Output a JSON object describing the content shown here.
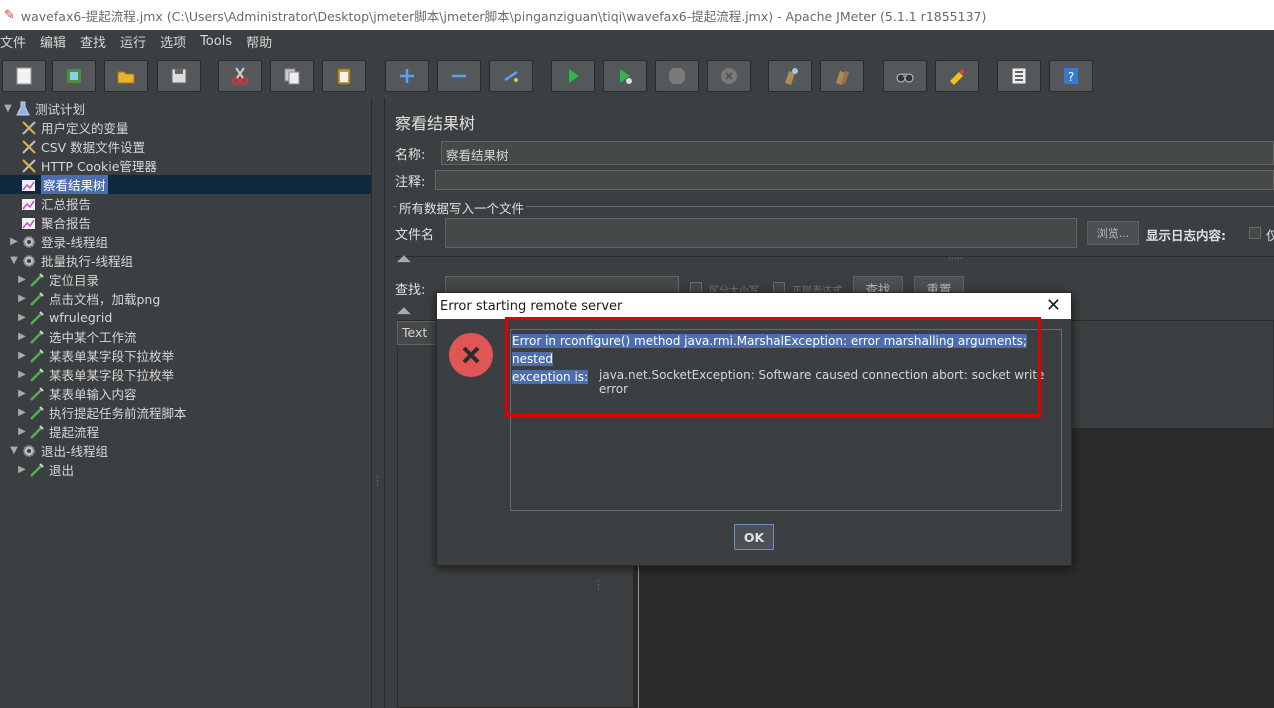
{
  "window": {
    "title": "wavefax6-提起流程.jmx (C:\\Users\\Administrator\\Desktop\\jmeter脚本\\jmeter脚本\\pinganziguan\\tiqi\\wavefax6-提起流程.jmx) - Apache JMeter (5.1.1 r1855137)"
  },
  "menu": [
    "文件",
    "编辑",
    "查找",
    "运行",
    "选项",
    "Tools",
    "帮助"
  ],
  "toolbar": {
    "icons": [
      "new-icon",
      "templates-icon",
      "open-icon",
      "save-icon",
      "cut-icon",
      "copy-icon",
      "paste-icon",
      "expand-icon",
      "collapse-icon",
      "toggle-icon",
      "start-icon",
      "start-no-pause-icon",
      "stop-icon",
      "shutdown-icon",
      "clear-icon",
      "clear-all-icon",
      "search-icon",
      "reset-search-icon",
      "function-helper-icon",
      "help-icon"
    ]
  },
  "tree": {
    "items": [
      {
        "label": "测试计划",
        "icon": "test-plan-icon",
        "indent": 0,
        "arrow": "▼"
      },
      {
        "label": "用户定义的变量",
        "icon": "config-icon",
        "indent": 1,
        "arrow": ""
      },
      {
        "label": "CSV 数据文件设置",
        "icon": "config-icon",
        "indent": 1,
        "arrow": ""
      },
      {
        "label": "HTTP Cookie管理器",
        "icon": "config-icon",
        "indent": 1,
        "arrow": ""
      },
      {
        "label": "察看结果树",
        "icon": "listener-icon",
        "indent": 1,
        "arrow": "",
        "selected": true
      },
      {
        "label": "汇总报告",
        "icon": "listener-icon",
        "indent": 1,
        "arrow": ""
      },
      {
        "label": "聚合报告",
        "icon": "listener-icon",
        "indent": 1,
        "arrow": ""
      },
      {
        "label": "登录-线程组",
        "icon": "thread-group-icon",
        "indent": 1,
        "arrow": "▶"
      },
      {
        "label": "批量执行-线程组",
        "icon": "thread-group-icon",
        "indent": 1,
        "arrow": "▼"
      },
      {
        "label": "定位目录",
        "icon": "sampler-icon",
        "indent": 2,
        "arrow": "▶"
      },
      {
        "label": "点击文档，加载png",
        "icon": "sampler-icon",
        "indent": 2,
        "arrow": "▶"
      },
      {
        "label": "wfrulegrid",
        "icon": "sampler-icon",
        "indent": 2,
        "arrow": "▶"
      },
      {
        "label": "选中某个工作流",
        "icon": "sampler-icon",
        "indent": 2,
        "arrow": "▶"
      },
      {
        "label": "某表单某字段下拉枚举",
        "icon": "sampler-icon",
        "indent": 2,
        "arrow": "▶"
      },
      {
        "label": "某表单某字段下拉枚举",
        "icon": "sampler-icon",
        "indent": 2,
        "arrow": "▶"
      },
      {
        "label": "某表单输入内容",
        "icon": "sampler-icon",
        "indent": 2,
        "arrow": "▶"
      },
      {
        "label": "执行提起任务前流程脚本",
        "icon": "sampler-icon",
        "indent": 2,
        "arrow": "▶"
      },
      {
        "label": "提起流程",
        "icon": "sampler-icon",
        "indent": 2,
        "arrow": "▶"
      },
      {
        "label": "退出-线程组",
        "icon": "thread-group-icon",
        "indent": 1,
        "arrow": "▼"
      },
      {
        "label": "退出",
        "icon": "sampler-icon",
        "indent": 2,
        "arrow": "▶"
      }
    ]
  },
  "panel": {
    "title": "察看结果树",
    "name_label": "名称:",
    "name_value": "察看结果树",
    "comment_label": "注释:",
    "group_legend": "所有数据写入一个文件",
    "filename_label": "文件名",
    "browse_label": "浏览...",
    "log_content_label": "显示日志内容:",
    "log_content_tail": "仅",
    "search_label": "查找:",
    "case_sensitive_label": "区分大小写",
    "regex_label": "正则表达式",
    "find_button": "查找",
    "reset_button": "重置",
    "renderer_value": "Text"
  },
  "dialog": {
    "title": "Error starting remote server",
    "message_line1": "Error in rconfigure() method java.rmi.MarshalException: error marshalling arguments; nested",
    "message_line2": "exception is:",
    "message_line3": "java.net.SocketException: Software caused connection abort: socket write error",
    "ok_label": "OK"
  }
}
